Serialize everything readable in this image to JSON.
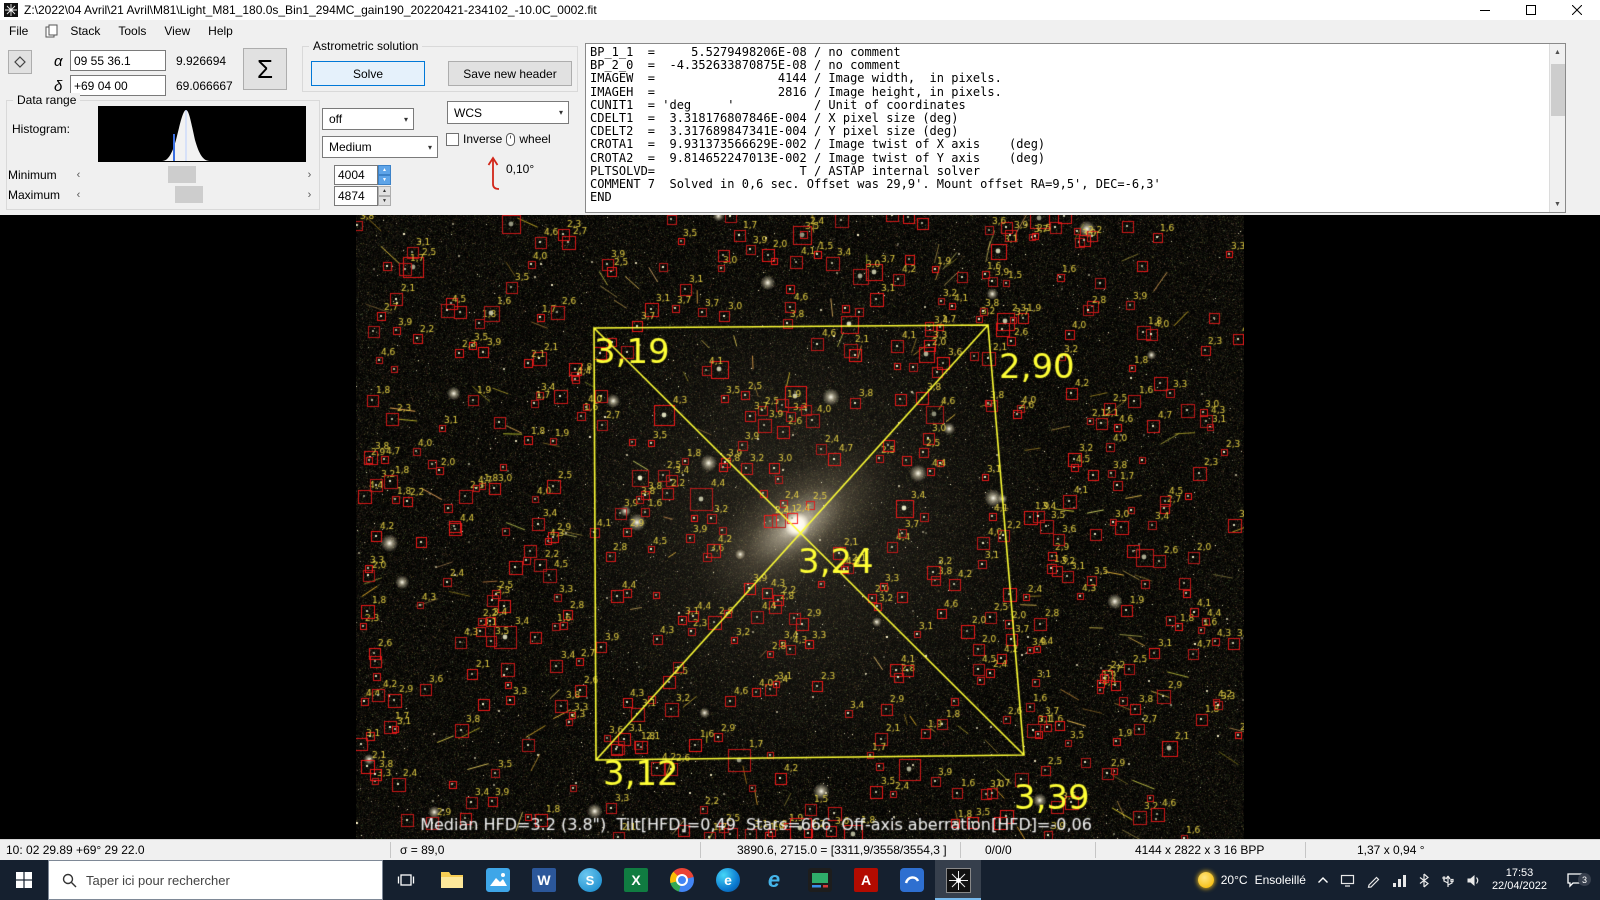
{
  "window": {
    "title": "Z:\\2022\\04 Avril\\21 Avril\\M81\\Light_M81_180.0s_Bin1_294MC_gain190_20220421-234102_-10.0C_0002.fit"
  },
  "menu": {
    "items": [
      "File",
      "Stack",
      "Tools",
      "View",
      "Help"
    ]
  },
  "toolbar": {
    "alpha_symbol": "α",
    "alpha_value": "09 55 36.1",
    "alpha_decimal": "9.926694",
    "delta_symbol": "δ",
    "delta_value": "+69 04 00",
    "delta_decimal": "69.066667",
    "sigma_label": "Σ",
    "astrometric_group_label": "Astrometric solution",
    "solve_button": "Solve",
    "save_header_button": "Save new header",
    "data_range_label": "Data range",
    "histogram_label": "Histogram:",
    "minimum_label": "Minimum",
    "maximum_label": "Maximum",
    "minimum_value": "4004",
    "maximum_value": "4874",
    "annotation_select": "off",
    "stretch_select": "Medium",
    "wcs_select": "WCS",
    "inverse_label": "Inverse",
    "wheel_label": "wheel",
    "rotation_value": "0,10°"
  },
  "fits_header": {
    "text": "BP_1_1  =     5.5279498206E-08 / no comment\nBP_2_0  =  -4.352633870875E-08 / no comment\nIMAGEW  =                 4144 / Image width,  in pixels.\nIMAGEH  =                 2816 / Image height, in pixels.\nCUNIT1  = 'deg     '           / Unit of coordinates\nCDELT1  =  3.318176807846E-004 / X pixel size (deg)\nCDELT2  =  3.317689847341E-004 / Y pixel size (deg)\nCROTA1  =  9.931373566629E-002 / Image twist of X axis    (deg)\nCROTA2  =  9.814652247013E-002 / Image twist of Y axis    (deg)\nPLTSOLVD=                    T / ASTAP internal solver\nCOMMENT 7  Solved in 0,6 sec. Offset was 29,9'. Mount offset RA=9,5', DEC=-6,3'\nEND"
  },
  "image_overlay": {
    "hfd_top_left": "3,19",
    "hfd_top_right": "2,90",
    "hfd_center": "3,24",
    "hfd_bottom_left": "3,12",
    "hfd_bottom_right": "3,39",
    "median_line": "Median HFD=3.2 (3.8\")  Tilt[HFD]=0,49  Stars=666  Off-axis aberration[HFD]=-0,06"
  },
  "status_bar": {
    "mouse_coords": "10: 02  29.89   +69° 29  22.0",
    "sigma": "σ = 89,0",
    "pixel_value": "3890.6, 2715.0 = [3311,9/3558/3554,3 ]",
    "counters": "0/0/0",
    "image_size": "4144 x 2822 x 3   16 BPP",
    "field_of_view": "1,37 x 0,94 °"
  },
  "taskbar": {
    "search_placeholder": "Taper ici pour rechercher",
    "weather_temp": "20°C",
    "weather_condition": "Ensoleillé",
    "time": "17:53",
    "date": "22/04/2022",
    "notification_count": "3",
    "pinned_apps": [
      "file-explorer",
      "photos",
      "word",
      "skype",
      "excel",
      "chrome",
      "edge",
      "internet-explorer",
      "imaging-app",
      "acrobat",
      "blue-swirl-app",
      "astap"
    ],
    "active_app": "astap",
    "tray_icons": [
      "monitor",
      "pen",
      "network",
      "bluetooth",
      "usb",
      "volume"
    ]
  }
}
